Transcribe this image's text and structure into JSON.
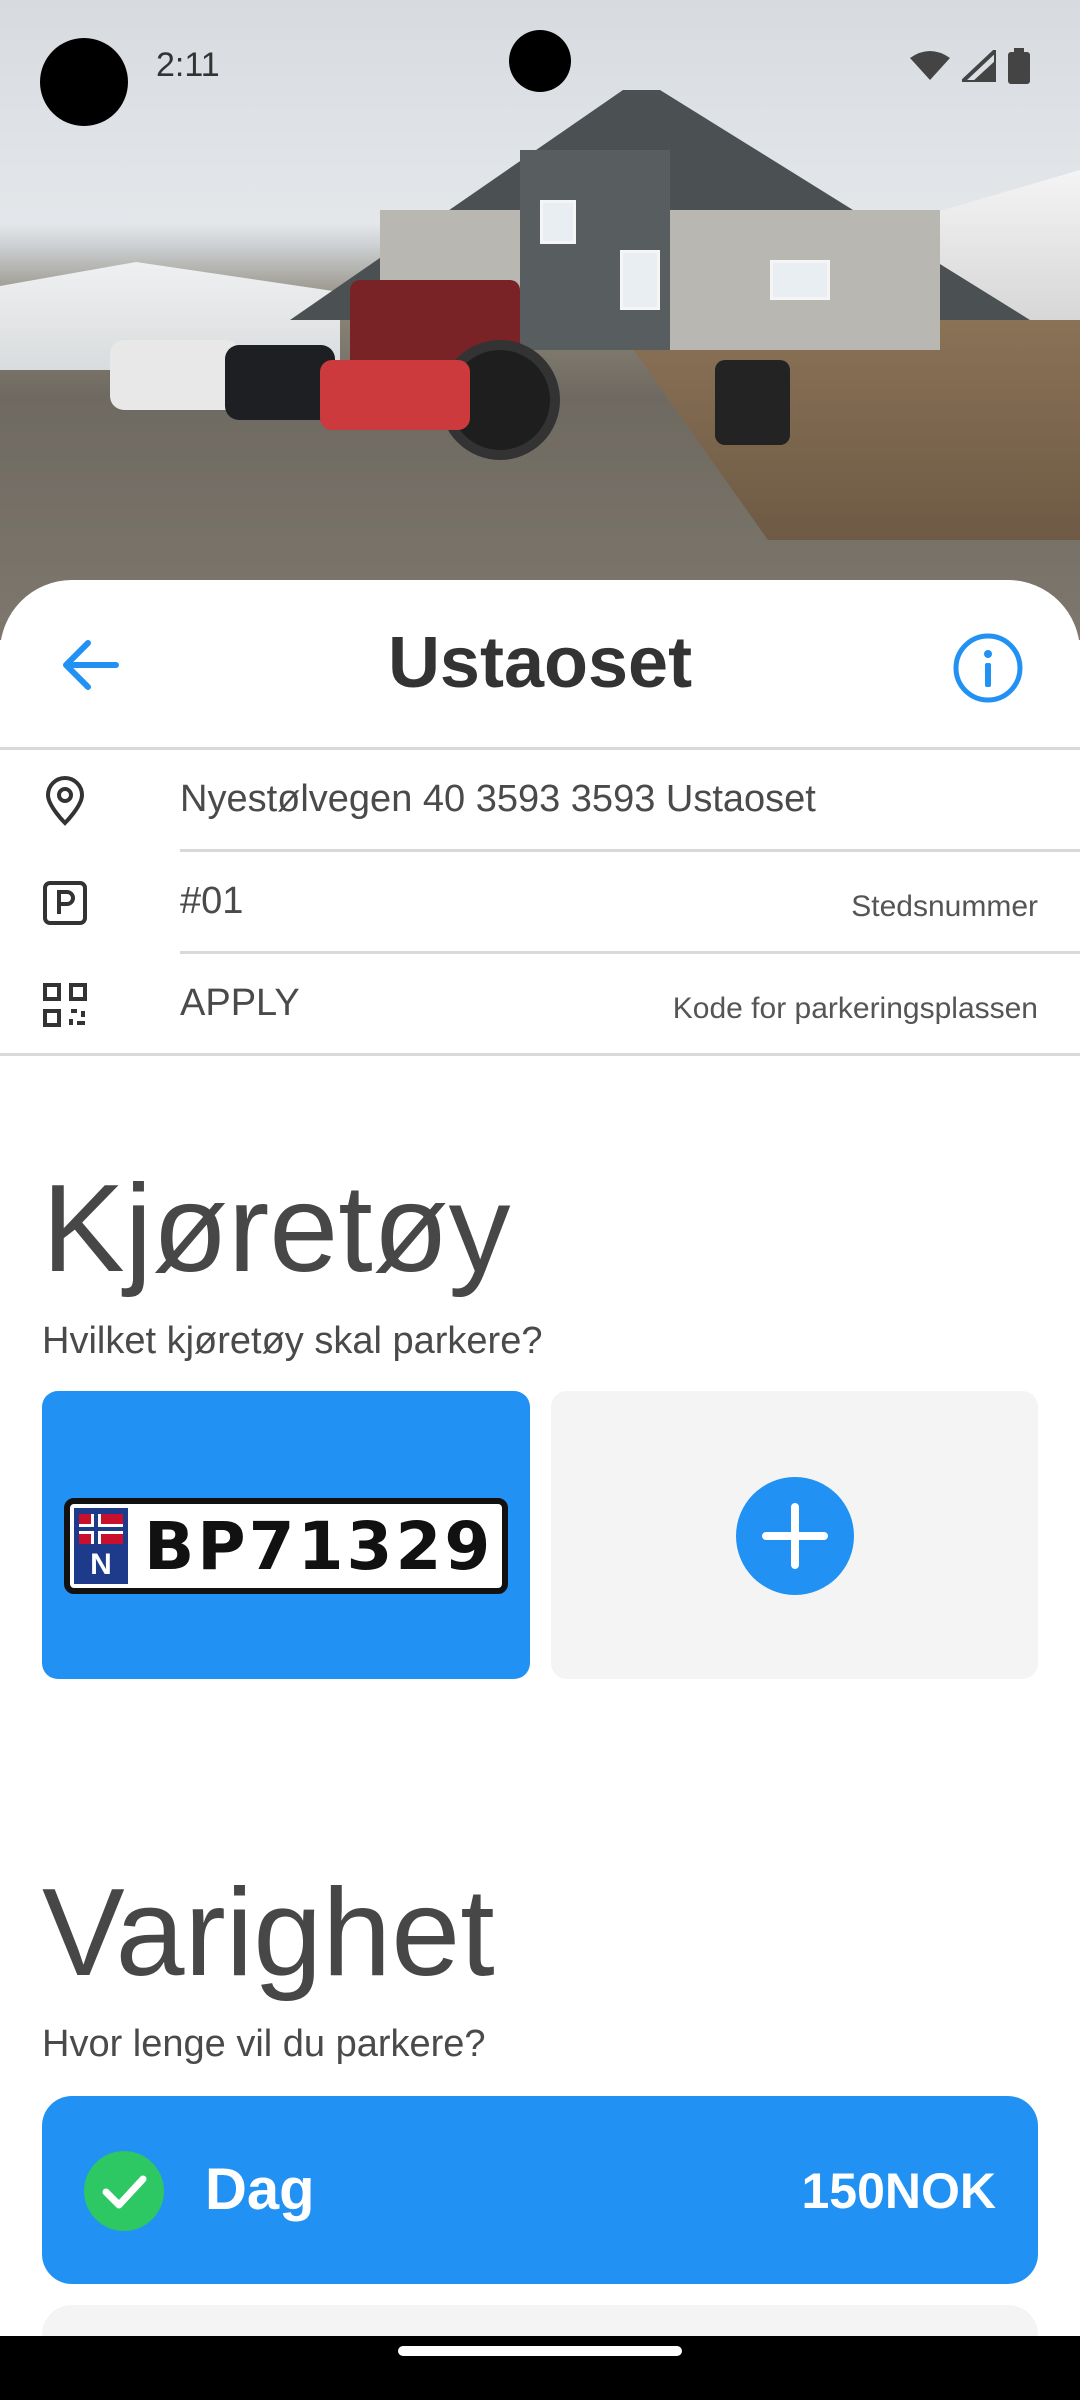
{
  "status_bar": {
    "time": "2:11",
    "icons": [
      "wifi-icon",
      "signal-icon",
      "battery-icon"
    ]
  },
  "header": {
    "title": "Ustaoset",
    "back_icon": "arrow-left-icon",
    "info_icon": "info-icon"
  },
  "location": {
    "address": "Nyestølvegen 40 3593 3593 Ustaoset",
    "place_number": "#01",
    "place_number_hint": "Stedsnummer",
    "code": "APPLY",
    "code_hint": "Kode for parkeringsplassen"
  },
  "vehicle": {
    "title": "Kjøretøy",
    "subtitle": "Hvilket kjøretøy skal parkere?",
    "plate_country": "N",
    "plate": "BP71329",
    "add_icon": "plus-circle-icon"
  },
  "duration": {
    "title": "Varighet",
    "subtitle": "Hvor lenge vil du parkere?",
    "selected_label": "Dag",
    "selected_price": "150NOK"
  },
  "colors": {
    "accent": "#2191F3",
    "check": "#2DC764",
    "text": "#333333"
  }
}
